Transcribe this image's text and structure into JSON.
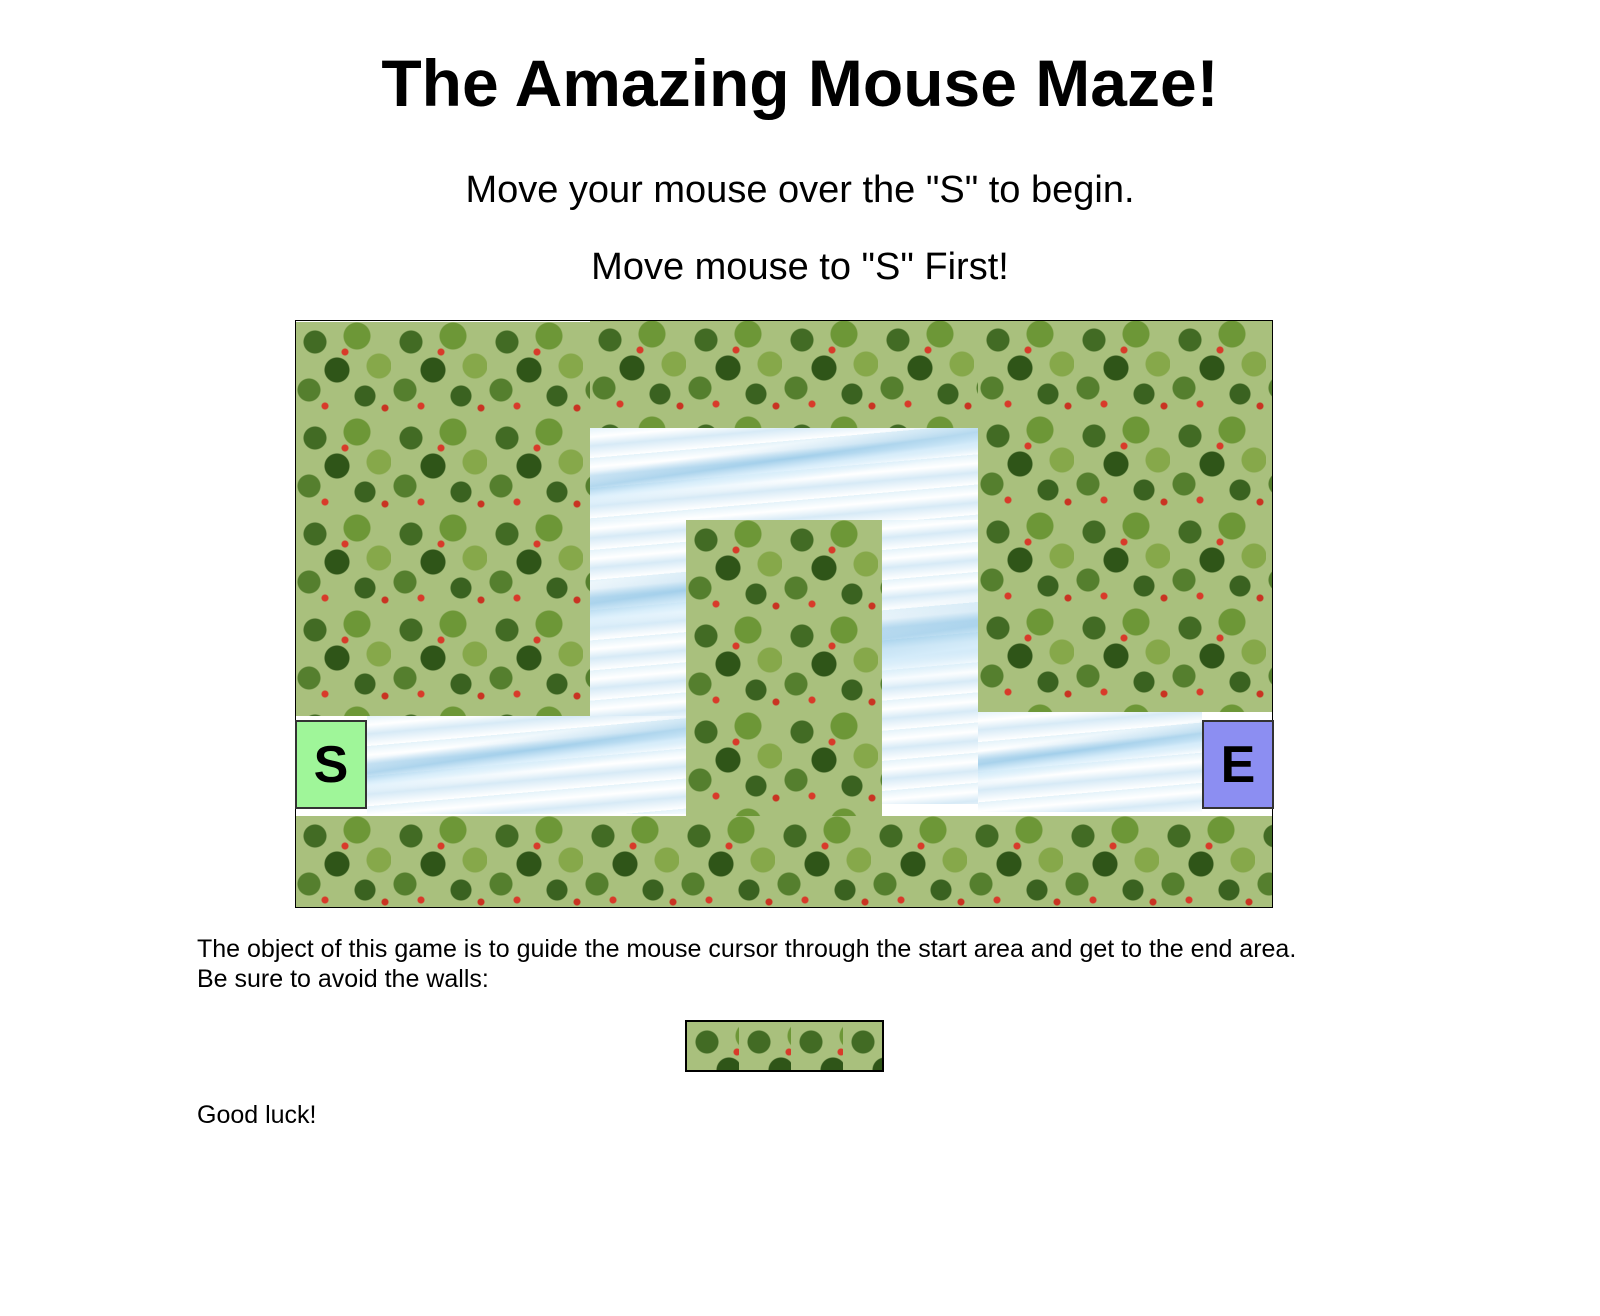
{
  "title": "The Amazing Mouse Maze!",
  "instructions": {
    "begin": "Move your mouse over the \"S\" to begin.",
    "status": "Move mouse to \"S\" First!"
  },
  "maze": {
    "start_label": "S",
    "end_label": "E",
    "wall_texture": "forest-trees-pattern",
    "path_texture": "water-waves",
    "start_color": "#9ff699",
    "end_color": "#8c8ef2"
  },
  "description": {
    "line1": "The object of this game is to guide the mouse cursor through the start area and get to the end area.",
    "line2": "Be sure to avoid the walls:",
    "closing": "Good luck!"
  }
}
